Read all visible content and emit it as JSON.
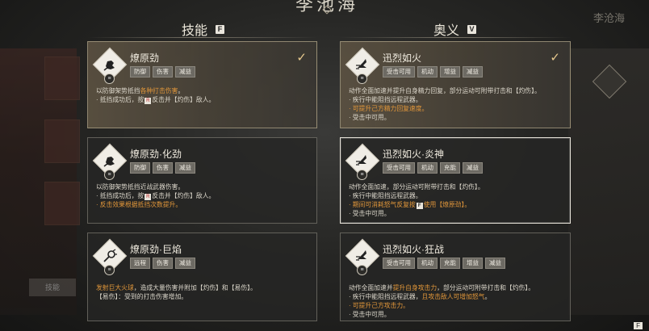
{
  "header": {
    "title": "李池海"
  },
  "right_panel_name": "李沧海",
  "bottom_left_label": "技能",
  "corner_hint": "F",
  "columns": {
    "skills": {
      "label": "技能",
      "key": "F"
    },
    "ultimates": {
      "label": "奥义",
      "key": "V"
    }
  },
  "skills": [
    {
      "title": "燎原劲",
      "icon": "fist-icon",
      "tags": [
        "防御",
        "伤害",
        "减益"
      ],
      "selected": true,
      "lines": [
        {
          "text": "以防御架势抵挡",
          "hl": "各种打击伤害",
          "after": "。"
        },
        {
          "text": "· 抵挡成功后，按",
          "btn": "R",
          "after": "反击并【灼伤】敌人。"
        }
      ]
    },
    {
      "title": "燎原劲·化劲",
      "icon": "fist-icon",
      "tags": [
        "防御",
        "伤害",
        "减益"
      ],
      "selected": false,
      "lines": [
        {
          "text": "以防御架势抵挡近战武器伤害。"
        },
        {
          "text": "· 抵挡成功后，按",
          "btn": "R",
          "after": "反击并【灼伤】敌人。"
        },
        {
          "hl": "· 反击效果根据抵挡次数提升。"
        }
      ]
    },
    {
      "title": "燎原劲·巨焰",
      "icon": "flame-orb-icon",
      "tags": [
        "远程",
        "伤害",
        "减益"
      ],
      "selected": false,
      "lines": [
        {
          "hl": "发射巨大火球",
          "after": "，造成大量伤害并附加【灼伤】和【易伤】。"
        },
        {
          "text": "【易伤】：受到的打击伤害增加。"
        }
      ]
    }
  ],
  "ultimates": [
    {
      "title": "迅烈如火",
      "icon": "dash-icon",
      "tags": [
        "受击可用",
        "机动",
        "增益",
        "减益"
      ],
      "selected": true,
      "lines": [
        {
          "text": "动作全面加速并提升自身精力回复，部分运动可附带打击和【灼伤】。"
        },
        {
          "text": "· 疾行中能阻挡远程武器。"
        },
        {
          "hl": "· 可提升己方精力回复速度。"
        },
        {
          "text": "· 受击中可用。"
        }
      ]
    },
    {
      "title": "迅烈如火·炎神",
      "icon": "dash-icon",
      "tags": [
        "受击可用",
        "机动",
        "充能",
        "减益"
      ],
      "selected": false,
      "focus": true,
      "lines": [
        {
          "text": "动作全面加速，部分运动可附带打击和【灼伤】。"
        },
        {
          "text": "· 疾行中能阻挡远程武器。"
        },
        {
          "hl": "· 期间可消耗怒气反复按",
          "btn": "F",
          "hl2": "使用【燎原劲】。"
        },
        {
          "text": "· 受击中可用。"
        }
      ]
    },
    {
      "title": "迅烈如火·狂战",
      "icon": "dash-icon",
      "tags": [
        "受击可用",
        "机动",
        "充能",
        "增益",
        "减益"
      ],
      "selected": false,
      "lines": [
        {
          "text": "动作全面加速并",
          "hl": "提升自身攻击力",
          "after": "，部分运动可附带打击和【灼伤】。"
        },
        {
          "text": "· 疾行中能阻挡远程武器，",
          "hl": "且攻击敌人可增加怒气",
          "after": "。"
        },
        {
          "hl": "· 可提升己方攻击力。"
        },
        {
          "text": "· 受击中可用。"
        }
      ]
    }
  ]
}
